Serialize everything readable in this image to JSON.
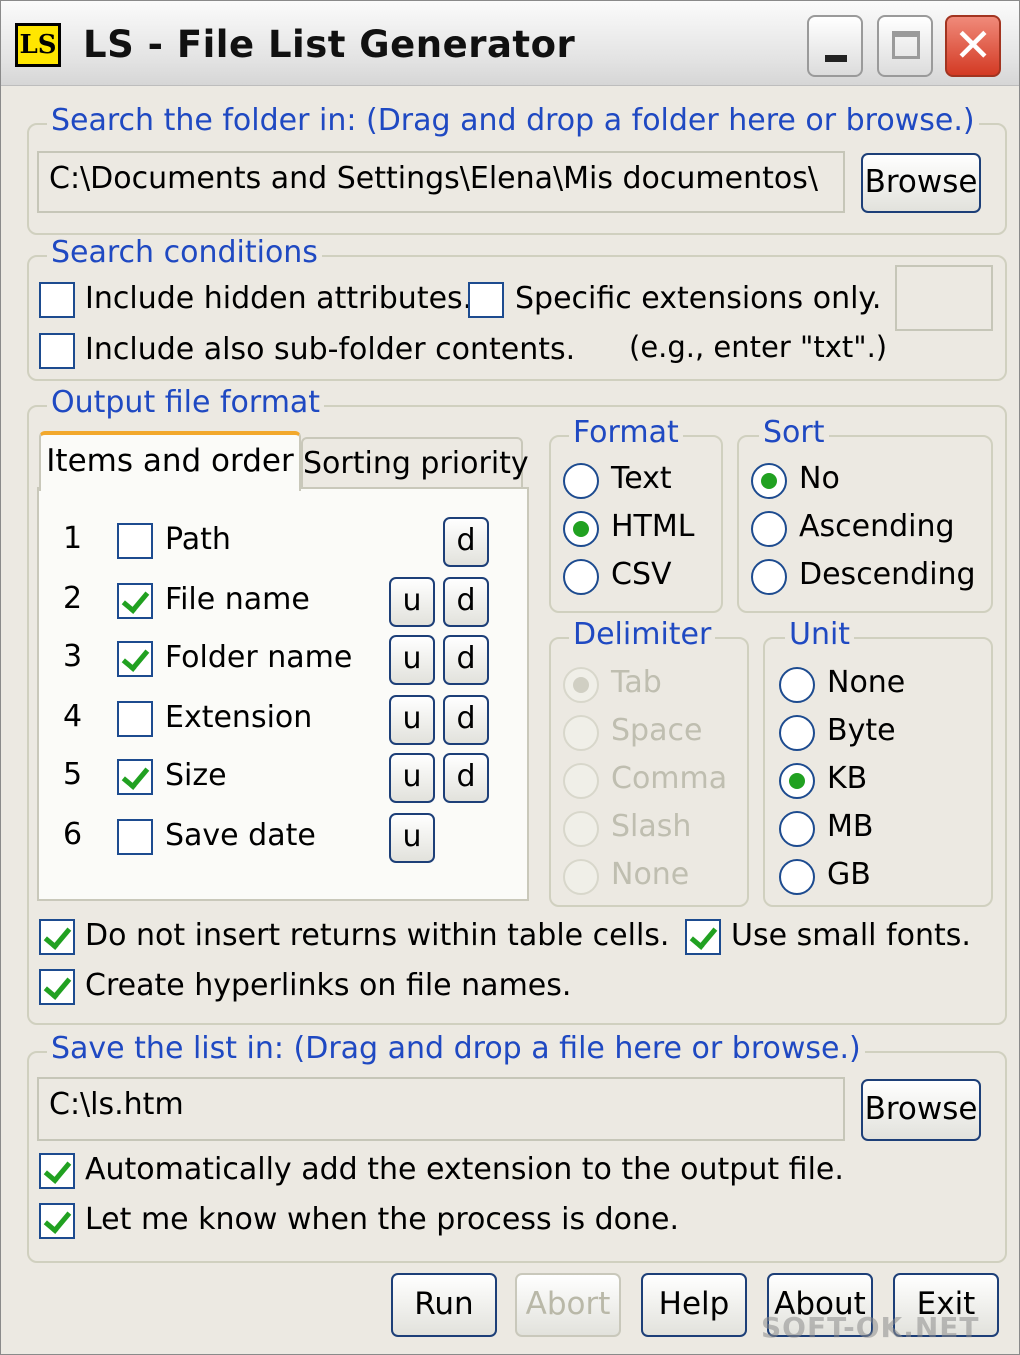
{
  "window": {
    "icon_text": "LS",
    "title": "LS - File List Generator",
    "close_glyph": "✕"
  },
  "search_folder": {
    "legend": "Search the folder in: (Drag and drop a folder here or browse.)",
    "path_value": "C:\\Documents and Settings\\Elena\\Mis documentos\\",
    "browse_label": "Browse"
  },
  "search_conditions": {
    "legend": "Search conditions",
    "hidden_label": "Include hidden attributes.",
    "hidden_checked": false,
    "extensions_label": "Specific extensions only.",
    "extensions_checked": false,
    "extensions_value": "",
    "subfolder_label": "Include also sub-folder contents.",
    "subfolder_checked": false,
    "hint": "(e.g., enter \"txt\".)"
  },
  "output_format": {
    "legend": "Output file format",
    "tabs": [
      "Items and order",
      "Sorting priority"
    ],
    "active_tab": "Items and order",
    "items": [
      {
        "num": "1",
        "label": "Path",
        "checked": false,
        "up": "",
        "down": "d"
      },
      {
        "num": "2",
        "label": "File name",
        "checked": true,
        "up": "u",
        "down": "d"
      },
      {
        "num": "3",
        "label": "Folder name",
        "checked": true,
        "up": "u",
        "down": "d"
      },
      {
        "num": "4",
        "label": "Extension",
        "checked": false,
        "up": "u",
        "down": "d"
      },
      {
        "num": "5",
        "label": "Size",
        "checked": true,
        "up": "u",
        "down": "d"
      },
      {
        "num": "6",
        "label": "Save date",
        "checked": false,
        "up": "u",
        "down": ""
      }
    ],
    "format": {
      "legend": "Format",
      "options": [
        "Text",
        "HTML",
        "CSV"
      ],
      "selected": "HTML"
    },
    "sort": {
      "legend": "Sort",
      "options": [
        "No",
        "Ascending",
        "Descending"
      ],
      "selected": "No"
    },
    "delimiter": {
      "legend": "Delimiter",
      "options": [
        "Tab",
        "Space",
        "Comma",
        "Slash",
        "None"
      ],
      "selected": "Tab",
      "disabled": true
    },
    "unit": {
      "legend": "Unit",
      "options": [
        "None",
        "Byte",
        "KB",
        "MB",
        "GB"
      ],
      "selected": "KB"
    },
    "no_returns_label": "Do not insert returns within table cells.",
    "no_returns_checked": true,
    "small_fonts_label": "Use small fonts.",
    "small_fonts_checked": true,
    "hyperlinks_label": "Create hyperlinks on file names.",
    "hyperlinks_checked": true
  },
  "save_list": {
    "legend": "Save the list in: (Drag and drop a file here or browse.)",
    "path_value": "C:\\ls.htm",
    "browse_label": "Browse",
    "auto_ext_label": "Automatically add the extension to the output file.",
    "auto_ext_checked": true,
    "notify_label": "Let me know when the process is done.",
    "notify_checked": true
  },
  "footer": {
    "run": "Run",
    "abort": "Abort",
    "help": "Help",
    "about": "About",
    "exit": "Exit"
  },
  "watermark": "SOFT-OK.NET"
}
